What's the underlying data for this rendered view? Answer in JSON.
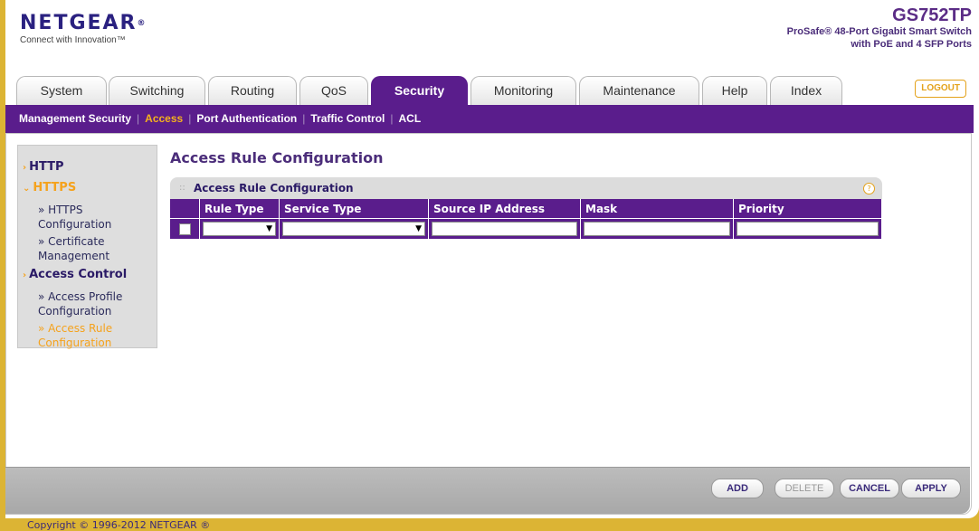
{
  "header": {
    "logo": "NETGEAR",
    "logo_reg": "®",
    "tagline": "Connect with Innovation™",
    "model": "GS752TP",
    "desc_line1": "ProSafe® 48-Port Gigabit Smart Switch",
    "desc_line2": "with PoE and 4 SFP Ports"
  },
  "tabs": [
    "System",
    "Switching",
    "Routing",
    "QoS",
    "Security",
    "Monitoring",
    "Maintenance",
    "Help",
    "Index"
  ],
  "active_tab": "Security",
  "logout": "LOGOUT",
  "subnav": [
    "Management Security",
    "Access",
    "Port Authentication",
    "Traffic Control",
    "ACL"
  ],
  "active_subnav": "Access",
  "sidebar": {
    "http": "HTTP",
    "https": "HTTPS",
    "https_config": "» HTTPS Configuration",
    "cert_mgmt": "» Certificate Management",
    "access_control": "Access Control",
    "access_profile": "» Access Profile Configuration",
    "access_rule": "» Access Rule Configuration"
  },
  "page_title": "Access Rule Configuration",
  "panel": {
    "title": "Access Rule Configuration",
    "help": "?",
    "columns": [
      "Rule Type",
      "Service Type",
      "Source IP Address",
      "Mask",
      "Priority"
    ],
    "row": {
      "rule_type": "",
      "service_type": "",
      "source_ip": "",
      "mask": "",
      "priority": ""
    }
  },
  "buttons": {
    "add": "ADD",
    "delete": "DELETE",
    "cancel": "CANCEL",
    "apply": "APPLY"
  },
  "copyright": "Copyright © 1996-2012 NETGEAR ®",
  "colors": {
    "brand_purple": "#5a1d8c",
    "accent_orange": "#f5a21c",
    "border_gold": "#dcb434"
  }
}
